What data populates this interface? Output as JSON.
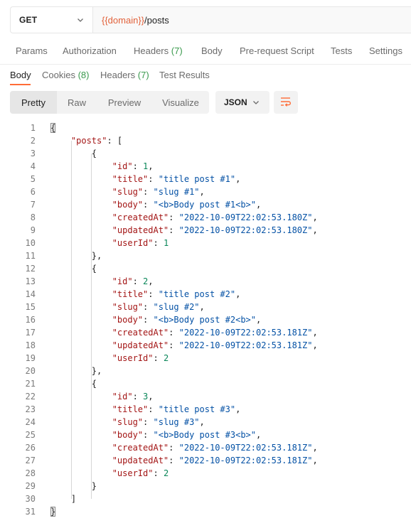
{
  "request": {
    "method": "GET",
    "url_variable": "{{domain}}",
    "url_path": "/posts"
  },
  "request_tabs": [
    {
      "label": "Params",
      "count": ""
    },
    {
      "label": "Authorization",
      "count": ""
    },
    {
      "label": "Headers",
      "count": "(7)"
    },
    {
      "label": "Body",
      "count": ""
    },
    {
      "label": "Pre-request Script",
      "count": ""
    },
    {
      "label": "Tests",
      "count": ""
    },
    {
      "label": "Settings",
      "count": ""
    }
  ],
  "response_tabs": [
    {
      "label": "Body",
      "count": "",
      "active": true
    },
    {
      "label": "Cookies",
      "count": "(8)"
    },
    {
      "label": "Headers",
      "count": "(7)"
    },
    {
      "label": "Test Results",
      "count": ""
    }
  ],
  "view_modes": [
    "Pretty",
    "Raw",
    "Preview",
    "Visualize"
  ],
  "active_view": "Pretty",
  "format": "JSON",
  "icons": {
    "method_dropdown": "chevron-down-icon",
    "format_dropdown": "chevron-down-icon",
    "wrap": "wrap-lines-icon"
  },
  "colors": {
    "accent": "#ff6c37",
    "url_variable": "#e2613a",
    "count": "#3a9a4d",
    "json_key": "#a31515",
    "json_string": "#0451a5",
    "json_number": "#098658"
  },
  "response_body": {
    "lines": [
      {
        "n": "1",
        "indent": 0,
        "tokens": [
          {
            "t": "punc",
            "v": "{"
          }
        ]
      },
      {
        "n": "2",
        "indent": 1,
        "tokens": [
          {
            "t": "key",
            "v": "\"posts\""
          },
          {
            "t": "punc",
            "v": ": ["
          }
        ]
      },
      {
        "n": "3",
        "indent": 2,
        "tokens": [
          {
            "t": "punc",
            "v": "{"
          }
        ]
      },
      {
        "n": "4",
        "indent": 3,
        "tokens": [
          {
            "t": "key",
            "v": "\"id\""
          },
          {
            "t": "punc",
            "v": ": "
          },
          {
            "t": "num",
            "v": "1"
          },
          {
            "t": "punc",
            "v": ","
          }
        ]
      },
      {
        "n": "5",
        "indent": 3,
        "tokens": [
          {
            "t": "key",
            "v": "\"title\""
          },
          {
            "t": "punc",
            "v": ": "
          },
          {
            "t": "str",
            "v": "\"title post #1\""
          },
          {
            "t": "punc",
            "v": ","
          }
        ]
      },
      {
        "n": "6",
        "indent": 3,
        "tokens": [
          {
            "t": "key",
            "v": "\"slug\""
          },
          {
            "t": "punc",
            "v": ": "
          },
          {
            "t": "str",
            "v": "\"slug #1\""
          },
          {
            "t": "punc",
            "v": ","
          }
        ]
      },
      {
        "n": "7",
        "indent": 3,
        "tokens": [
          {
            "t": "key",
            "v": "\"body\""
          },
          {
            "t": "punc",
            "v": ": "
          },
          {
            "t": "str",
            "v": "\"<b>Body post #1<b>\""
          },
          {
            "t": "punc",
            "v": ","
          }
        ]
      },
      {
        "n": "8",
        "indent": 3,
        "tokens": [
          {
            "t": "key",
            "v": "\"createdAt\""
          },
          {
            "t": "punc",
            "v": ": "
          },
          {
            "t": "str",
            "v": "\"2022-10-09T22:02:53.180Z\""
          },
          {
            "t": "punc",
            "v": ","
          }
        ]
      },
      {
        "n": "9",
        "indent": 3,
        "tokens": [
          {
            "t": "key",
            "v": "\"updatedAt\""
          },
          {
            "t": "punc",
            "v": ": "
          },
          {
            "t": "str",
            "v": "\"2022-10-09T22:02:53.180Z\""
          },
          {
            "t": "punc",
            "v": ","
          }
        ]
      },
      {
        "n": "10",
        "indent": 3,
        "tokens": [
          {
            "t": "key",
            "v": "\"userId\""
          },
          {
            "t": "punc",
            "v": ": "
          },
          {
            "t": "num",
            "v": "1"
          }
        ]
      },
      {
        "n": "11",
        "indent": 2,
        "tokens": [
          {
            "t": "punc",
            "v": "},"
          }
        ]
      },
      {
        "n": "12",
        "indent": 2,
        "tokens": [
          {
            "t": "punc",
            "v": "{"
          }
        ]
      },
      {
        "n": "13",
        "indent": 3,
        "tokens": [
          {
            "t": "key",
            "v": "\"id\""
          },
          {
            "t": "punc",
            "v": ": "
          },
          {
            "t": "num",
            "v": "2"
          },
          {
            "t": "punc",
            "v": ","
          }
        ]
      },
      {
        "n": "14",
        "indent": 3,
        "tokens": [
          {
            "t": "key",
            "v": "\"title\""
          },
          {
            "t": "punc",
            "v": ": "
          },
          {
            "t": "str",
            "v": "\"title post #2\""
          },
          {
            "t": "punc",
            "v": ","
          }
        ]
      },
      {
        "n": "15",
        "indent": 3,
        "tokens": [
          {
            "t": "key",
            "v": "\"slug\""
          },
          {
            "t": "punc",
            "v": ": "
          },
          {
            "t": "str",
            "v": "\"slug #2\""
          },
          {
            "t": "punc",
            "v": ","
          }
        ]
      },
      {
        "n": "16",
        "indent": 3,
        "tokens": [
          {
            "t": "key",
            "v": "\"body\""
          },
          {
            "t": "punc",
            "v": ": "
          },
          {
            "t": "str",
            "v": "\"<b>Body post #2<b>\""
          },
          {
            "t": "punc",
            "v": ","
          }
        ]
      },
      {
        "n": "17",
        "indent": 3,
        "tokens": [
          {
            "t": "key",
            "v": "\"createdAt\""
          },
          {
            "t": "punc",
            "v": ": "
          },
          {
            "t": "str",
            "v": "\"2022-10-09T22:02:53.181Z\""
          },
          {
            "t": "punc",
            "v": ","
          }
        ]
      },
      {
        "n": "18",
        "indent": 3,
        "tokens": [
          {
            "t": "key",
            "v": "\"updatedAt\""
          },
          {
            "t": "punc",
            "v": ": "
          },
          {
            "t": "str",
            "v": "\"2022-10-09T22:02:53.181Z\""
          },
          {
            "t": "punc",
            "v": ","
          }
        ]
      },
      {
        "n": "19",
        "indent": 3,
        "tokens": [
          {
            "t": "key",
            "v": "\"userId\""
          },
          {
            "t": "punc",
            "v": ": "
          },
          {
            "t": "num",
            "v": "2"
          }
        ]
      },
      {
        "n": "20",
        "indent": 2,
        "tokens": [
          {
            "t": "punc",
            "v": "},"
          }
        ]
      },
      {
        "n": "21",
        "indent": 2,
        "tokens": [
          {
            "t": "punc",
            "v": "{"
          }
        ]
      },
      {
        "n": "22",
        "indent": 3,
        "tokens": [
          {
            "t": "key",
            "v": "\"id\""
          },
          {
            "t": "punc",
            "v": ": "
          },
          {
            "t": "num",
            "v": "3"
          },
          {
            "t": "punc",
            "v": ","
          }
        ]
      },
      {
        "n": "23",
        "indent": 3,
        "tokens": [
          {
            "t": "key",
            "v": "\"title\""
          },
          {
            "t": "punc",
            "v": ": "
          },
          {
            "t": "str",
            "v": "\"title post #3\""
          },
          {
            "t": "punc",
            "v": ","
          }
        ]
      },
      {
        "n": "24",
        "indent": 3,
        "tokens": [
          {
            "t": "key",
            "v": "\"slug\""
          },
          {
            "t": "punc",
            "v": ": "
          },
          {
            "t": "str",
            "v": "\"slug #3\""
          },
          {
            "t": "punc",
            "v": ","
          }
        ]
      },
      {
        "n": "25",
        "indent": 3,
        "tokens": [
          {
            "t": "key",
            "v": "\"body\""
          },
          {
            "t": "punc",
            "v": ": "
          },
          {
            "t": "str",
            "v": "\"<b>Body post #3<b>\""
          },
          {
            "t": "punc",
            "v": ","
          }
        ]
      },
      {
        "n": "26",
        "indent": 3,
        "tokens": [
          {
            "t": "key",
            "v": "\"createdAt\""
          },
          {
            "t": "punc",
            "v": ": "
          },
          {
            "t": "str",
            "v": "\"2022-10-09T22:02:53.181Z\""
          },
          {
            "t": "punc",
            "v": ","
          }
        ]
      },
      {
        "n": "27",
        "indent": 3,
        "tokens": [
          {
            "t": "key",
            "v": "\"updatedAt\""
          },
          {
            "t": "punc",
            "v": ": "
          },
          {
            "t": "str",
            "v": "\"2022-10-09T22:02:53.181Z\""
          },
          {
            "t": "punc",
            "v": ","
          }
        ]
      },
      {
        "n": "28",
        "indent": 3,
        "tokens": [
          {
            "t": "key",
            "v": "\"userId\""
          },
          {
            "t": "punc",
            "v": ": "
          },
          {
            "t": "num",
            "v": "2"
          }
        ]
      },
      {
        "n": "29",
        "indent": 2,
        "tokens": [
          {
            "t": "punc",
            "v": "}"
          }
        ]
      },
      {
        "n": "30",
        "indent": 1,
        "tokens": [
          {
            "t": "punc",
            "v": "]"
          }
        ]
      },
      {
        "n": "31",
        "indent": 0,
        "tokens": [
          {
            "t": "punc",
            "v": "}"
          }
        ]
      }
    ]
  }
}
